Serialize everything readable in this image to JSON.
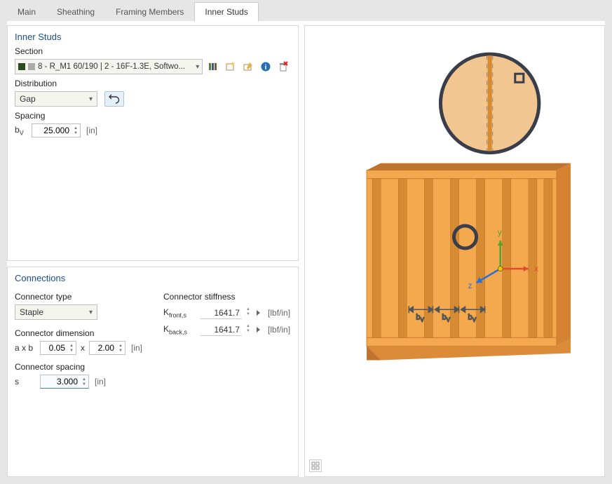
{
  "tabs": {
    "main": "Main",
    "sheathing": "Sheathing",
    "framing": "Framing Members",
    "inner": "Inner Studs"
  },
  "inner_studs": {
    "title": "Inner Studs",
    "section_label": "Section",
    "section_value": "8 - R_M1 60/190 | 2 - 16F-1.3E, Softwo...",
    "distribution_label": "Distribution",
    "distribution_value": "Gap",
    "spacing_label": "Spacing",
    "spacing_var": "b",
    "spacing_sub": "V",
    "spacing_value": "25.000",
    "spacing_unit": "[in]"
  },
  "connections": {
    "title": "Connections",
    "type_label": "Connector type",
    "type_value": "Staple",
    "dim_label": "Connector dimension",
    "dim_prefix": "a x b",
    "dim_a": "0.05",
    "dim_sep": "x",
    "dim_b": "2.00",
    "dim_unit": "[in]",
    "spacing_label": "Connector spacing",
    "spacing_var": "s",
    "spacing_value": "3.000",
    "spacing_unit": "[in]",
    "stiffness_label": "Connector stiffness",
    "k_front_label": "K",
    "k_front_sub": "front,s",
    "k_front_value": "1641.7",
    "k_back_label": "K",
    "k_back_sub": "back,s",
    "k_back_value": "1641.7",
    "stiff_unit": "[lbf/in]"
  },
  "viewport": {
    "axis_x": "x",
    "axis_y": "y",
    "axis_z": "z",
    "bv": "b",
    "bv_sub": "V"
  }
}
